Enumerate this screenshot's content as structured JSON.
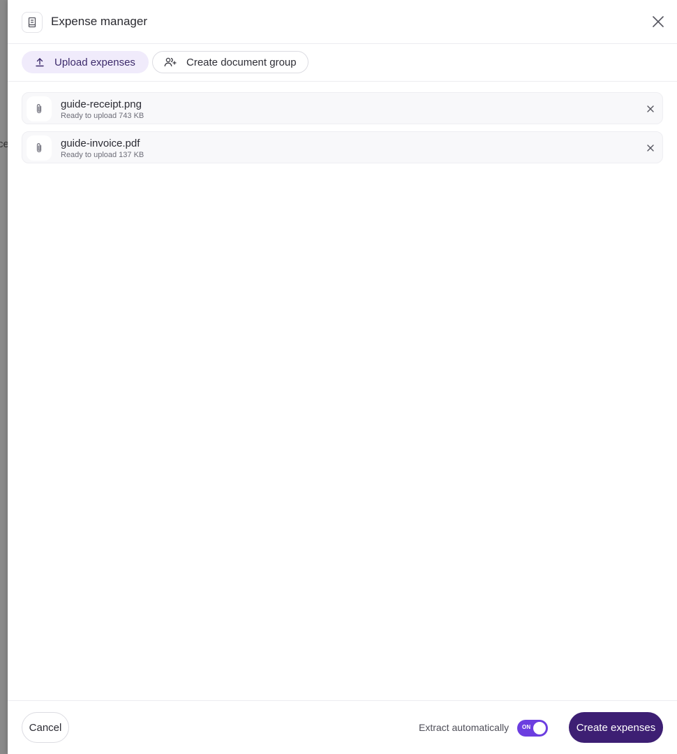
{
  "backdrop": {
    "text": "ce"
  },
  "header": {
    "title": "Expense manager",
    "icon": "receipt-icon",
    "close_icon": "close-icon"
  },
  "tabs": [
    {
      "label": "Upload expenses",
      "icon": "upload-icon",
      "active": true
    },
    {
      "label": "Create document group",
      "icon": "users-plus-icon",
      "active": false
    }
  ],
  "files": [
    {
      "name": "guide-receipt.png",
      "status": "Ready to upload 743 KB",
      "icon": "paperclip-icon"
    },
    {
      "name": "guide-invoice.pdf",
      "status": "Ready to upload 137 KB",
      "icon": "paperclip-icon"
    }
  ],
  "footer": {
    "cancel_label": "Cancel",
    "extract_label": "Extract automatically",
    "toggle_text": "ON",
    "toggle_on": true,
    "create_label": "Create expenses"
  },
  "colors": {
    "accent": "#6c3ee0",
    "primary_button": "#3d1f73",
    "active_tab_bg": "#f0ebfb"
  }
}
